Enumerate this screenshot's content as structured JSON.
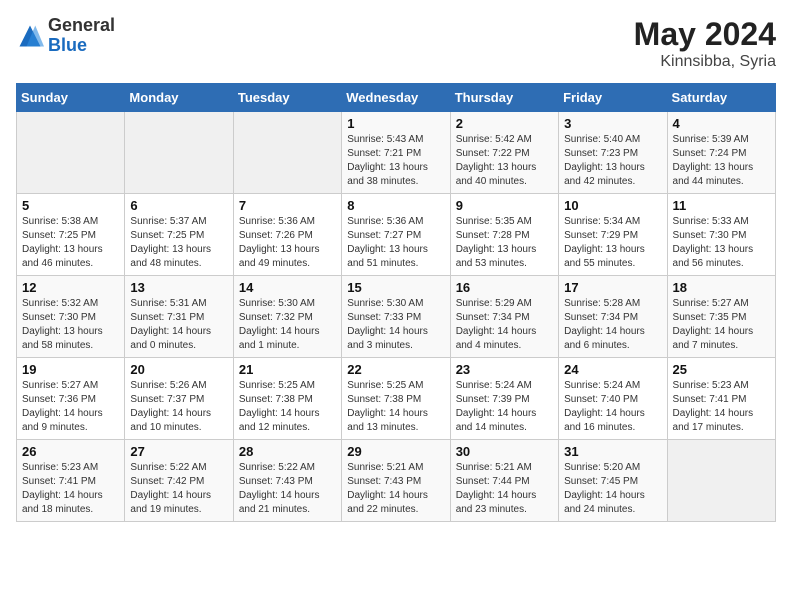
{
  "header": {
    "logo_general": "General",
    "logo_blue": "Blue",
    "month_year": "May 2024",
    "location": "Kinnsibba, Syria"
  },
  "weekdays": [
    "Sunday",
    "Monday",
    "Tuesday",
    "Wednesday",
    "Thursday",
    "Friday",
    "Saturday"
  ],
  "weeks": [
    [
      {
        "day": "",
        "info": ""
      },
      {
        "day": "",
        "info": ""
      },
      {
        "day": "",
        "info": ""
      },
      {
        "day": "1",
        "info": "Sunrise: 5:43 AM\nSunset: 7:21 PM\nDaylight: 13 hours\nand 38 minutes."
      },
      {
        "day": "2",
        "info": "Sunrise: 5:42 AM\nSunset: 7:22 PM\nDaylight: 13 hours\nand 40 minutes."
      },
      {
        "day": "3",
        "info": "Sunrise: 5:40 AM\nSunset: 7:23 PM\nDaylight: 13 hours\nand 42 minutes."
      },
      {
        "day": "4",
        "info": "Sunrise: 5:39 AM\nSunset: 7:24 PM\nDaylight: 13 hours\nand 44 minutes."
      }
    ],
    [
      {
        "day": "5",
        "info": "Sunrise: 5:38 AM\nSunset: 7:25 PM\nDaylight: 13 hours\nand 46 minutes."
      },
      {
        "day": "6",
        "info": "Sunrise: 5:37 AM\nSunset: 7:25 PM\nDaylight: 13 hours\nand 48 minutes."
      },
      {
        "day": "7",
        "info": "Sunrise: 5:36 AM\nSunset: 7:26 PM\nDaylight: 13 hours\nand 49 minutes."
      },
      {
        "day": "8",
        "info": "Sunrise: 5:36 AM\nSunset: 7:27 PM\nDaylight: 13 hours\nand 51 minutes."
      },
      {
        "day": "9",
        "info": "Sunrise: 5:35 AM\nSunset: 7:28 PM\nDaylight: 13 hours\nand 53 minutes."
      },
      {
        "day": "10",
        "info": "Sunrise: 5:34 AM\nSunset: 7:29 PM\nDaylight: 13 hours\nand 55 minutes."
      },
      {
        "day": "11",
        "info": "Sunrise: 5:33 AM\nSunset: 7:30 PM\nDaylight: 13 hours\nand 56 minutes."
      }
    ],
    [
      {
        "day": "12",
        "info": "Sunrise: 5:32 AM\nSunset: 7:30 PM\nDaylight: 13 hours\nand 58 minutes."
      },
      {
        "day": "13",
        "info": "Sunrise: 5:31 AM\nSunset: 7:31 PM\nDaylight: 14 hours\nand 0 minutes."
      },
      {
        "day": "14",
        "info": "Sunrise: 5:30 AM\nSunset: 7:32 PM\nDaylight: 14 hours\nand 1 minute."
      },
      {
        "day": "15",
        "info": "Sunrise: 5:30 AM\nSunset: 7:33 PM\nDaylight: 14 hours\nand 3 minutes."
      },
      {
        "day": "16",
        "info": "Sunrise: 5:29 AM\nSunset: 7:34 PM\nDaylight: 14 hours\nand 4 minutes."
      },
      {
        "day": "17",
        "info": "Sunrise: 5:28 AM\nSunset: 7:34 PM\nDaylight: 14 hours\nand 6 minutes."
      },
      {
        "day": "18",
        "info": "Sunrise: 5:27 AM\nSunset: 7:35 PM\nDaylight: 14 hours\nand 7 minutes."
      }
    ],
    [
      {
        "day": "19",
        "info": "Sunrise: 5:27 AM\nSunset: 7:36 PM\nDaylight: 14 hours\nand 9 minutes."
      },
      {
        "day": "20",
        "info": "Sunrise: 5:26 AM\nSunset: 7:37 PM\nDaylight: 14 hours\nand 10 minutes."
      },
      {
        "day": "21",
        "info": "Sunrise: 5:25 AM\nSunset: 7:38 PM\nDaylight: 14 hours\nand 12 minutes."
      },
      {
        "day": "22",
        "info": "Sunrise: 5:25 AM\nSunset: 7:38 PM\nDaylight: 14 hours\nand 13 minutes."
      },
      {
        "day": "23",
        "info": "Sunrise: 5:24 AM\nSunset: 7:39 PM\nDaylight: 14 hours\nand 14 minutes."
      },
      {
        "day": "24",
        "info": "Sunrise: 5:24 AM\nSunset: 7:40 PM\nDaylight: 14 hours\nand 16 minutes."
      },
      {
        "day": "25",
        "info": "Sunrise: 5:23 AM\nSunset: 7:41 PM\nDaylight: 14 hours\nand 17 minutes."
      }
    ],
    [
      {
        "day": "26",
        "info": "Sunrise: 5:23 AM\nSunset: 7:41 PM\nDaylight: 14 hours\nand 18 minutes."
      },
      {
        "day": "27",
        "info": "Sunrise: 5:22 AM\nSunset: 7:42 PM\nDaylight: 14 hours\nand 19 minutes."
      },
      {
        "day": "28",
        "info": "Sunrise: 5:22 AM\nSunset: 7:43 PM\nDaylight: 14 hours\nand 21 minutes."
      },
      {
        "day": "29",
        "info": "Sunrise: 5:21 AM\nSunset: 7:43 PM\nDaylight: 14 hours\nand 22 minutes."
      },
      {
        "day": "30",
        "info": "Sunrise: 5:21 AM\nSunset: 7:44 PM\nDaylight: 14 hours\nand 23 minutes."
      },
      {
        "day": "31",
        "info": "Sunrise: 5:20 AM\nSunset: 7:45 PM\nDaylight: 14 hours\nand 24 minutes."
      },
      {
        "day": "",
        "info": ""
      }
    ]
  ]
}
